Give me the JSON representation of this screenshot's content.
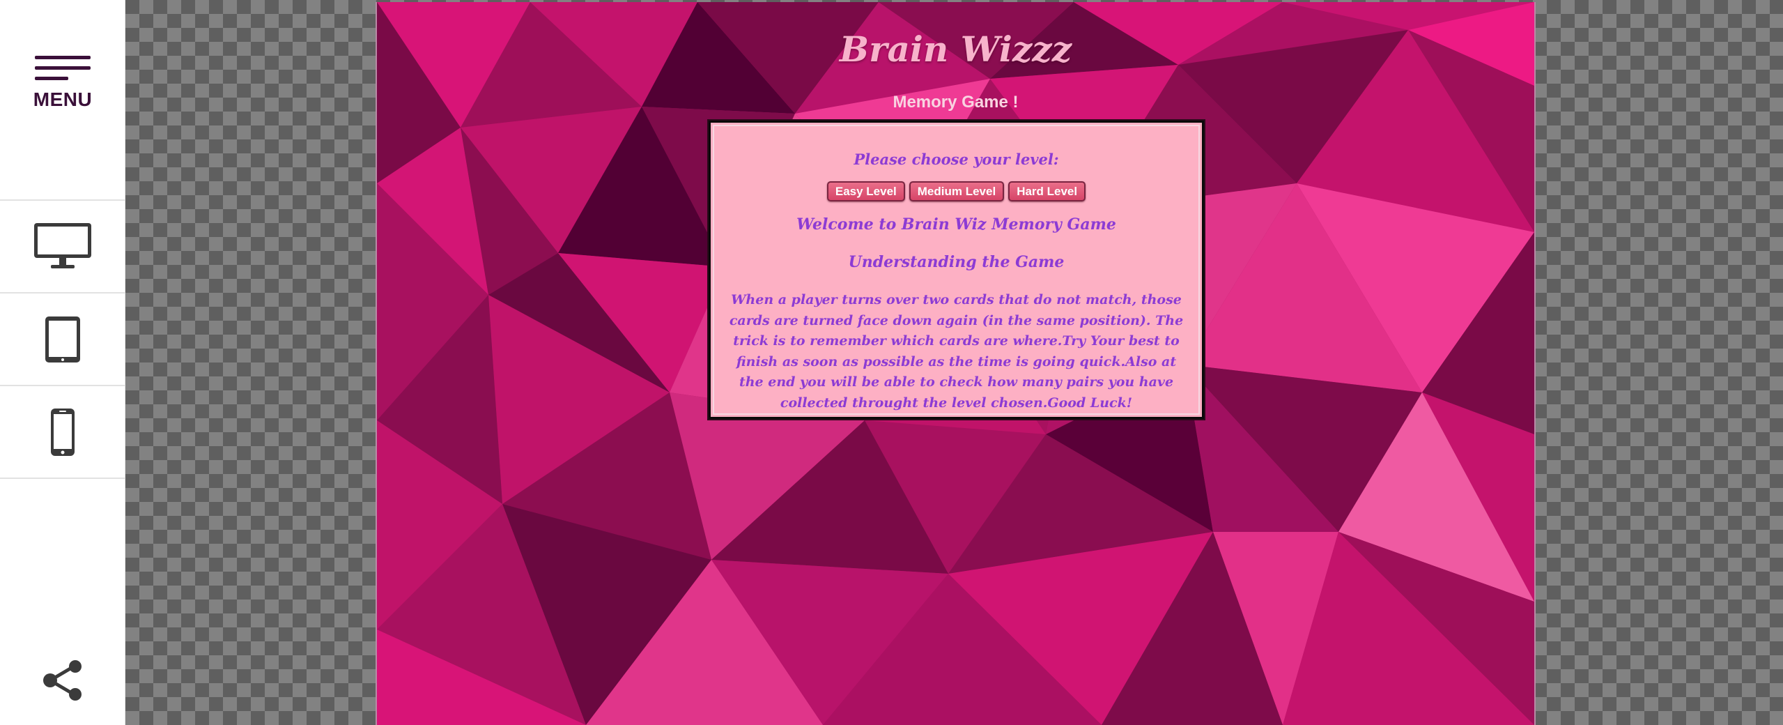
{
  "sidebar": {
    "menu_label": "MENU",
    "devices": [
      {
        "icon": "desktop-icon"
      },
      {
        "icon": "tablet-icon"
      },
      {
        "icon": "mobile-icon"
      }
    ],
    "share_icon": "share-icon"
  },
  "game": {
    "title": "Brain Wizzz",
    "subtitle": "Memory Game !",
    "level_prompt": "Please choose your level:",
    "levels": [
      "Easy Level",
      "Medium Level",
      "Hard Level"
    ],
    "welcome": "Welcome to Brain Wiz Memory Game",
    "understanding": "Understanding the Game",
    "rules": "When a player turns over two cards that do not match, those cards are turned face down again (in the same position). The trick is to remember which cards are where.Try Your best to finish as soon as possible as the time is going quick.Also at the end you will be able to check how many pairs you have collected throught the level chosen.Good Luck!"
  },
  "colors": {
    "sidebar_accent": "#3a1039",
    "background_pink": "#a8115f",
    "box_pink": "#fdb0c4",
    "text_purple": "#8c3bd4",
    "button_pink": "#d64568"
  }
}
